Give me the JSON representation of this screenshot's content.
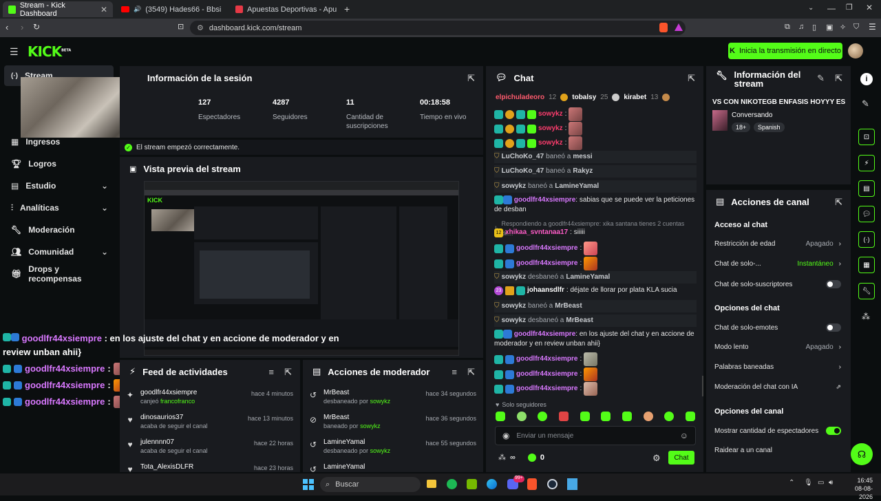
{
  "browser": {
    "tabs": [
      {
        "label": "Stream - Kick Dashboard",
        "active": true
      },
      {
        "label": "(3549) Hades66 - Bbsita Te VeS B"
      },
      {
        "label": "Apuestas Deportivas - Apuesta Onlin"
      }
    ],
    "url": "dashboard.kick.com/stream"
  },
  "header": {
    "logo": "KICK",
    "logo_tag": "BETA",
    "go_live": "Inicia la transmisión en directo"
  },
  "sidebar": {
    "items": [
      {
        "label": "Stream"
      },
      {
        "label": "Ingresos"
      },
      {
        "label": "Logros"
      },
      {
        "label": "Estudio"
      },
      {
        "label": "Analíticas"
      },
      {
        "label": "Moderación"
      },
      {
        "label": "Comunidad"
      },
      {
        "label": "Drops y recompensas"
      }
    ]
  },
  "session": {
    "title": "Información de la sesión",
    "stats": [
      {
        "value": "127",
        "label": "Espectadores"
      },
      {
        "value": "4287",
        "label": "Seguidores"
      },
      {
        "value": "11",
        "label": "Cantidad de suscripciones"
      },
      {
        "value": "00:18:58",
        "label": "Tiempo en vivo"
      }
    ],
    "status": "El stream empezó correctamente."
  },
  "preview": {
    "title": "Vista previa del stream"
  },
  "overlay": {
    "lines": [
      {
        "user": "goodlfr44xsiempre",
        "text": ": en los ajuste del chat y en accione de moderador y en review unban ahii}"
      },
      {
        "user": "goodlfr44xsiempre",
        "text": ":"
      },
      {
        "user": "goodlfr44xsiempre",
        "text": ":"
      },
      {
        "user": "goodlfr44xsiempre",
        "text": ":"
      }
    ]
  },
  "feed": {
    "title": "Feed de actividades",
    "rows": [
      {
        "user": "goodlfr44xsiempre",
        "pre": "canjeó",
        "target": "francofranco",
        "time": "hace 4 minutos"
      },
      {
        "user": "dinosaurios37",
        "pre": "acaba de seguir el canal",
        "target": "",
        "time": "hace 13 minutos"
      },
      {
        "user": "julennnn07",
        "pre": "acaba de seguir el canal",
        "target": "",
        "time": "hace 22 horas"
      },
      {
        "user": "Tota_AlexisDLFR",
        "pre": "",
        "target": "",
        "time": "hace 23 horas"
      }
    ]
  },
  "modactions": {
    "title": "Acciones de moderador",
    "rows": [
      {
        "user": "MrBeast",
        "pre": "desbaneado por",
        "target": "sowykz",
        "time": "hace 34 segundos"
      },
      {
        "user": "MrBeast",
        "pre": "baneado por",
        "target": "sowykz",
        "time": "hace 36 segundos"
      },
      {
        "user": "LamineYamal",
        "pre": "desbaneado por",
        "target": "sowykz",
        "time": "hace 55 segundos"
      },
      {
        "user": "LamineYamal",
        "pre": "",
        "target": "",
        "time": ""
      }
    ]
  },
  "chat": {
    "title": "Chat",
    "top_gifters": [
      {
        "name": "elpichuladeoro",
        "count": "12"
      },
      {
        "name": "tobalsy",
        "count": "25"
      },
      {
        "name": "kirabet",
        "count": "13"
      }
    ],
    "badge_numbers": [
      "32",
      "1",
      "12",
      "23",
      "2",
      "3"
    ],
    "messages": [
      {
        "user": "sowykz",
        "text": ":"
      },
      {
        "user": "sowykz",
        "text": ":"
      },
      {
        "user": "sowykz",
        "text": ":"
      },
      {
        "user": "LuChoKo_47",
        "action": "baneó a",
        "target": "messi"
      },
      {
        "user": "LuChoKo_47",
        "action": "baneó a",
        "target": "Rakyz"
      },
      {
        "user": "sowykz",
        "action": "baneó a",
        "target": "LamineYamal"
      },
      {
        "user": "goodlfr44xsiempre",
        "text": ": sabias que se puede ver la peticiones de desban"
      },
      {
        "reply": "Respondiendo a goodlfr44xsiempre: xika santana tienes 2 cuentas dif..."
      },
      {
        "user": "xhikaa_svntanaa17",
        "text": ": siiiii"
      },
      {
        "user": "goodlfr44xsiempre",
        "text": ":"
      },
      {
        "user": "goodlfr44xsiempre",
        "text": ":"
      },
      {
        "user": "sowykz",
        "action": "desbaneó a",
        "target": "LamineYamal"
      },
      {
        "user": "johaansdlfr",
        "text": ": déjate de llorar por plata KLA sucia"
      },
      {
        "user": "sowykz",
        "action": "baneó a",
        "target": "MrBeast"
      },
      {
        "user": "sowykz",
        "action": "desbaneó a",
        "target": "MrBeast"
      },
      {
        "user": "goodlfr44xsiempre",
        "text": ": en los ajuste del chat y en accione de moderador y en review unban ahii}"
      },
      {
        "user": "goodlfr44xsiempre",
        "text": ":"
      },
      {
        "user": "goodlfr44xsiempre",
        "text": ":"
      },
      {
        "user": "goodlfr44xsiempre",
        "text": ":"
      }
    ],
    "followers_only": "Solo seguidores",
    "input_placeholder": "Enviar un mensaje",
    "infinity": "∞",
    "kick_count": "0",
    "send_label": "Chat"
  },
  "stream_info": {
    "title": "Información del stream",
    "stream_title": "VS CON NIKOTEGB ENFASIS HOYYY ES",
    "category": "Conversando",
    "tags": [
      "18+",
      "Spanish"
    ]
  },
  "channel_actions": {
    "title": "Acciones de canal",
    "sections": {
      "chat_access": "Acceso al chat",
      "chat_options": "Opciones del chat",
      "channel_options": "Opciones del canal"
    },
    "age_restriction": {
      "label": "Restricción de edad",
      "value": "Apagado"
    },
    "followers_only": {
      "label": "Chat de solo-...",
      "value": "Instantáneo"
    },
    "subs_only": {
      "label": "Chat de solo-suscriptores"
    },
    "emotes_only": {
      "label": "Chat de solo-emotes"
    },
    "slow_mode": {
      "label": "Modo lento",
      "value": "Apagado"
    },
    "banned_words": {
      "label": "Palabras baneadas"
    },
    "ai_moderation": {
      "label": "Moderación del chat con IA"
    },
    "show_viewers": {
      "label": "Mostrar cantidad de espectadores",
      "on": true
    },
    "raid": {
      "label": "Raidear a un canal"
    }
  },
  "taskbar": {
    "search": "Buscar",
    "time": "16:45",
    "date": "08-08-2026",
    "mail_badge": "99+"
  },
  "colors": {
    "accent": "#53fc18",
    "panel": "#191b1f",
    "bg": "#0b0e0f"
  }
}
